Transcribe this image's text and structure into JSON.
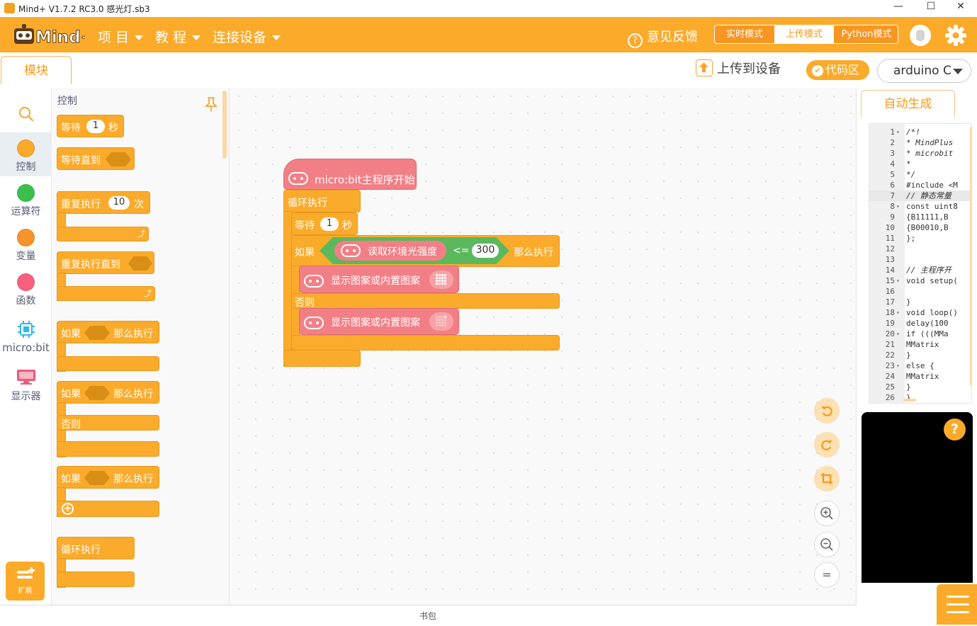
{
  "window": {
    "title": "Mind+ V1.7.2 RC3.0   感光灯.sb3",
    "minimize": "—",
    "maximize": "☐",
    "close": "✕"
  },
  "menu": {
    "project": "项 目",
    "tutorial": "教 程",
    "connect": "连接设备",
    "feedback": "意见反馈",
    "feedback_icon": "?"
  },
  "modes": {
    "realtime": "实时模式",
    "upload": "上传模式",
    "python": "Python模式",
    "active": "upload"
  },
  "toolbar": {
    "tab_blocks": "模块",
    "upload_label": "上传到设备",
    "code_area": "代码区",
    "board": "arduino C"
  },
  "categories": [
    {
      "label": "",
      "icon": "search-icon"
    },
    {
      "label": "控制",
      "color": "#fbaa2a"
    },
    {
      "label": "运算符",
      "color": "#3cc04d"
    },
    {
      "label": "变量",
      "color": "#f7942a"
    },
    {
      "label": "函数",
      "color": "#f9607e"
    },
    {
      "label": "micro:bit",
      "color": "#2fb7ec",
      "icon": "microbit-chip-icon"
    },
    {
      "label": "显示器",
      "color": "#e85d7a",
      "icon": "display-icon"
    }
  ],
  "extensions": {
    "label": "扩展"
  },
  "palette": {
    "title": "控制",
    "wait": "等待",
    "wait_value": "1",
    "sec": "秒",
    "wait_until": "等待直到",
    "repeat": "重复执行",
    "repeat_value": "10",
    "times": "次",
    "repeat_until": "重复执行直到",
    "if": "如果",
    "then": "那么执行",
    "else": "否则",
    "forever": "循环执行"
  },
  "script": {
    "hat": "micro:bit主程序开始",
    "forever": "循环执行",
    "wait": "等待",
    "wait_value": "1",
    "sec": "秒",
    "if": "如果",
    "sensor": "读取环境光强度",
    "op": "<=",
    "threshold": "300",
    "then": "那么执行",
    "show_pattern": "显示图案或内置图案",
    "else": "否则"
  },
  "right_panel": {
    "tab": "自动生成",
    "help": "?"
  },
  "code_lines": [
    {
      "n": "1",
      "t": "/*!",
      "fold": true,
      "cls": "cm"
    },
    {
      "n": "2",
      "t": " * MindPlus",
      "cls": "cm"
    },
    {
      "n": "3",
      "t": " * microbit",
      "cls": "cm"
    },
    {
      "n": "4",
      "t": " *",
      "cls": "cm"
    },
    {
      "n": "5",
      "t": " */",
      "cls": "cm"
    },
    {
      "n": "6",
      "t": "#include <M",
      "cls": "kw"
    },
    {
      "n": "7",
      "t": "// 静态常量",
      "cls": "cm",
      "hl": true
    },
    {
      "n": "8",
      "t": "const uint8",
      "fold": true,
      "cls": "kw"
    },
    {
      "n": "9",
      "t": "  {B11111,B"
    },
    {
      "n": "10",
      "t": "  {B00010,B"
    },
    {
      "n": "11",
      "t": "};"
    },
    {
      "n": "12",
      "t": ""
    },
    {
      "n": "13",
      "t": ""
    },
    {
      "n": "14",
      "t": "// 主程序开",
      "cls": "cm"
    },
    {
      "n": "15",
      "t": "void setup(",
      "fold": true,
      "cls": "kw"
    },
    {
      "n": "16",
      "t": ""
    },
    {
      "n": "17",
      "t": "}"
    },
    {
      "n": "18",
      "t": "void loop()",
      "fold": true,
      "cls": "kw"
    },
    {
      "n": "19",
      "t": "  delay(100"
    },
    {
      "n": "20",
      "t": "  if (((MMa",
      "fold": true
    },
    {
      "n": "21",
      "t": "    MMatrix"
    },
    {
      "n": "22",
      "t": "  }"
    },
    {
      "n": "23",
      "t": "  else {",
      "fold": true
    },
    {
      "n": "24",
      "t": "    MMatrix"
    },
    {
      "n": "25",
      "t": "  }"
    },
    {
      "n": "26",
      "t": "}"
    }
  ],
  "bottom": {
    "backpack": "书包"
  }
}
